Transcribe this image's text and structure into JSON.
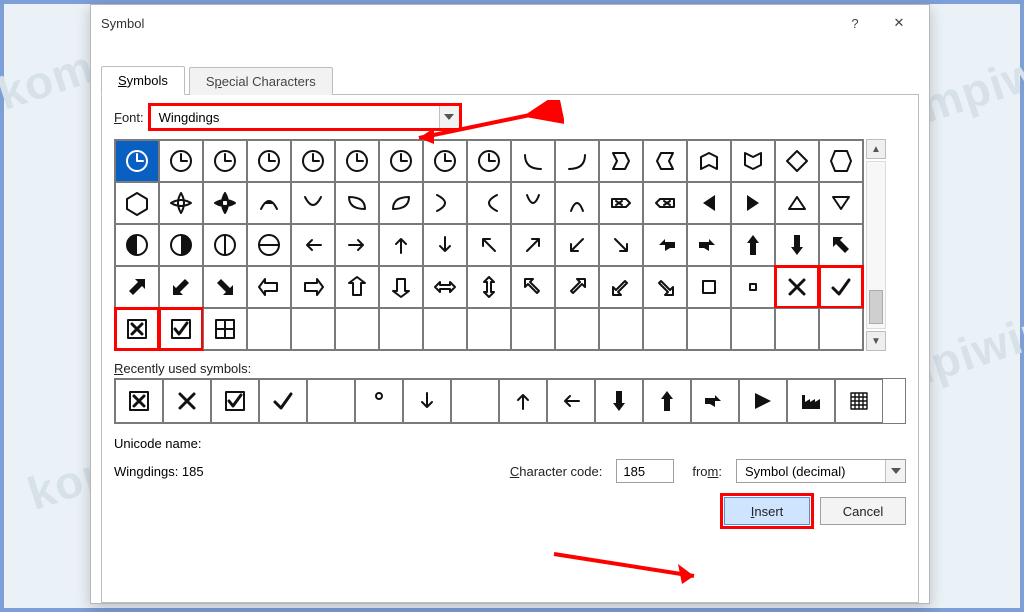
{
  "dialog": {
    "title": "Symbol",
    "help_icon": "?",
    "close_icon": "✕"
  },
  "tabs": {
    "symbols": "Symbols",
    "special": "Special Characters"
  },
  "font_row": {
    "label": "Font:",
    "value": "Wingdings"
  },
  "recent_label": "Recently used symbols:",
  "unicode": {
    "label": "Unicode name:",
    "value": "Wingdings: 185"
  },
  "charcode": {
    "label": "Character code:",
    "value": "185"
  },
  "from": {
    "label": "from:",
    "value": "Symbol (decimal)"
  },
  "buttons": {
    "insert": "Insert",
    "cancel": "Cancel"
  },
  "grid": {
    "selected_index": 0,
    "highlight_pairs": [
      [
        66,
        67
      ],
      [
        68,
        69
      ]
    ],
    "cells": [
      "clock",
      "clock",
      "clock",
      "clock",
      "clock",
      "clock",
      "clock",
      "clock",
      "clock",
      "curve-dl",
      "curve-dr",
      "ribbon1",
      "ribbon2",
      "ribbon3",
      "ribbon4",
      "ribbon5",
      "ribbon6",
      "ribbon7",
      "petal4",
      "petal4b",
      "loop1",
      "loop2",
      "loop3",
      "loop4",
      "loop5",
      "loop6",
      "loop7",
      "loop8",
      "boxx1",
      "boxx2",
      "tri-l",
      "tri-r",
      "tri-u",
      "tri-d",
      "half-l",
      "half-r",
      "circ-v",
      "circ-h",
      "arr-l",
      "arr-r",
      "arr-u",
      "arr-d",
      "arr-ul",
      "arr-ur",
      "arr-dl",
      "arr-dr",
      "arr-bl",
      "arr-br",
      "arr-bu",
      "arr-bd",
      "arr-bul",
      "arr-bur",
      "arr-bdl",
      "arr-bdr",
      "out-l",
      "out-r",
      "out-u",
      "out-d",
      "out-lr",
      "out-ud",
      "out-ul",
      "out-ur",
      "out-dl",
      "out-dr",
      "sq-big",
      "sq-sm",
      "x",
      "check",
      "box-x",
      "box-check",
      "window",
      "",
      "",
      "",
      "",
      "",
      "",
      "",
      "",
      "",
      "",
      "",
      "",
      "",
      ""
    ]
  },
  "recent": [
    "box-x",
    "x",
    "box-check",
    "check",
    "",
    "degree",
    "arr-d",
    "",
    "arr-u",
    "arr-l",
    "arr-bd",
    "arr-bu",
    "arr-br",
    "tri-rb",
    "factory",
    "grid4"
  ],
  "watermarks": [
    "kompiwin",
    "kompiwin",
    "kompiwin",
    "kompiwin",
    "kompiwin",
    "kompiwin"
  ]
}
